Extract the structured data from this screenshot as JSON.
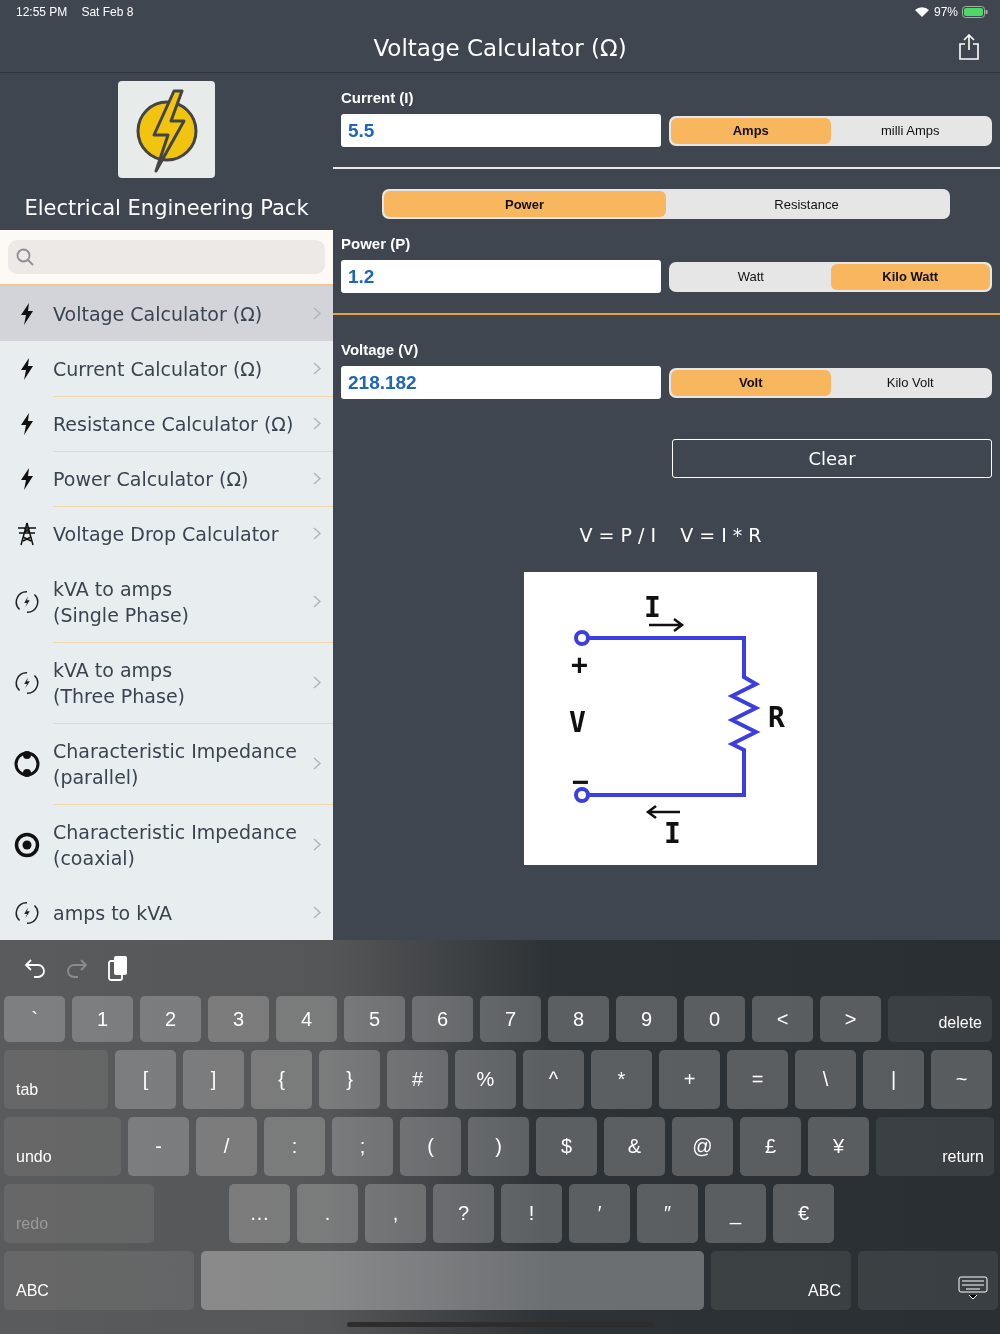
{
  "status_bar": {
    "time": "12:55 PM",
    "date": "Sat Feb 8",
    "battery": "97%"
  },
  "nav": {
    "title": "Voltage Calculator (Ω)"
  },
  "sidebar": {
    "app_title": "Electrical Engineering Pack",
    "items": [
      {
        "kind": "bolt",
        "label": "Voltage Calculator (Ω)",
        "selected": true
      },
      {
        "kind": "bolt",
        "label": "Current Calculator (Ω)",
        "selected": false
      },
      {
        "kind": "bolt",
        "label": "Resistance Calculator (Ω)",
        "selected": false
      },
      {
        "kind": "bolt",
        "label": "Power Calculator (Ω)",
        "selected": false
      },
      {
        "kind": "tower",
        "label": "Voltage Drop Calculator",
        "selected": false
      },
      {
        "kind": "cycle",
        "label": "kVA to amps\n(Single Phase)",
        "selected": false
      },
      {
        "kind": "cycle",
        "label": "kVA to amps\n(Three Phase)",
        "selected": false
      },
      {
        "kind": "parallel",
        "label": "Characteristic Impedance\n(parallel)",
        "selected": false
      },
      {
        "kind": "coaxial",
        "label": "Characteristic Impedance\n(coaxial)",
        "selected": false
      },
      {
        "kind": "cycle",
        "label": "amps to kVA",
        "selected": false
      }
    ]
  },
  "current": {
    "label": "Current (I)",
    "value": "5.5",
    "units": [
      {
        "label": "Amps",
        "selected": true
      },
      {
        "label": "milli Amps",
        "selected": false
      }
    ]
  },
  "mode": [
    {
      "label": "Power",
      "selected": true
    },
    {
      "label": "Resistance",
      "selected": false
    }
  ],
  "power": {
    "label": "Power (P)",
    "value": "1.2",
    "units": [
      {
        "label": "Watt",
        "selected": false
      },
      {
        "label": "Kilo Watt",
        "selected": true
      }
    ]
  },
  "voltage": {
    "label": "Voltage (V)",
    "value": "218.182",
    "units": [
      {
        "label": "Volt",
        "selected": true
      },
      {
        "label": "Kilo Volt",
        "selected": false
      }
    ]
  },
  "clear_button": "Clear",
  "formula": "V = P / I    V = I * R",
  "circuit_labels": [
    "I",
    "+",
    "V",
    "−",
    "R",
    "I"
  ],
  "keyboard": {
    "toolbar": [
      {
        "kind": "undo",
        "disabled": false
      },
      {
        "kind": "redo",
        "disabled": true
      },
      {
        "kind": "paste",
        "disabled": false
      }
    ],
    "rows": [
      {
        "keys": [
          {
            "kind": "char",
            "label": "`"
          },
          {
            "kind": "char",
            "label": "1"
          },
          {
            "kind": "char",
            "label": "2"
          },
          {
            "kind": "char",
            "label": "3"
          },
          {
            "kind": "char",
            "label": "4"
          },
          {
            "kind": "char",
            "label": "5"
          },
          {
            "kind": "char",
            "label": "6"
          },
          {
            "kind": "char",
            "label": "7"
          },
          {
            "kind": "char",
            "label": "8"
          },
          {
            "kind": "char",
            "label": "9"
          },
          {
            "kind": "char",
            "label": "0"
          },
          {
            "kind": "char",
            "label": "<"
          },
          {
            "kind": "char",
            "label": ">"
          },
          {
            "kind": "delete",
            "label": "delete"
          }
        ]
      },
      {
        "keys": [
          {
            "kind": "tab",
            "label": "tab"
          },
          {
            "kind": "char",
            "label": "["
          },
          {
            "kind": "char",
            "label": "]"
          },
          {
            "kind": "char",
            "label": "{"
          },
          {
            "kind": "char",
            "label": "}"
          },
          {
            "kind": "char",
            "label": "#"
          },
          {
            "kind": "char",
            "label": "%"
          },
          {
            "kind": "char",
            "label": "^"
          },
          {
            "kind": "char",
            "label": "*"
          },
          {
            "kind": "char",
            "label": "+"
          },
          {
            "kind": "char",
            "label": "="
          },
          {
            "kind": "char",
            "label": "\\"
          },
          {
            "kind": "char",
            "label": "|"
          },
          {
            "kind": "char",
            "label": "~"
          }
        ]
      },
      {
        "keys": [
          {
            "kind": "undo",
            "label": "undo"
          },
          {
            "kind": "char",
            "label": "-"
          },
          {
            "kind": "char",
            "label": "/"
          },
          {
            "kind": "char",
            "label": ":"
          },
          {
            "kind": "char",
            "label": ";"
          },
          {
            "kind": "char",
            "label": "("
          },
          {
            "kind": "char",
            "label": ")"
          },
          {
            "kind": "char",
            "label": "$"
          },
          {
            "kind": "char",
            "label": "&"
          },
          {
            "kind": "char",
            "label": "@"
          },
          {
            "kind": "char",
            "label": "£"
          },
          {
            "kind": "char",
            "label": "¥"
          },
          {
            "kind": "return",
            "label": "return"
          }
        ]
      },
      {
        "keys": [
          {
            "kind": "redo",
            "label": "redo"
          },
          {
            "kind": "char",
            "label": "…"
          },
          {
            "kind": "char",
            "label": "."
          },
          {
            "kind": "char",
            "label": ","
          },
          {
            "kind": "char",
            "label": "?"
          },
          {
            "kind": "char",
            "label": "!"
          },
          {
            "kind": "char",
            "label": "′"
          },
          {
            "kind": "char",
            "label": "″"
          },
          {
            "kind": "char",
            "label": "_"
          },
          {
            "kind": "char",
            "label": "€"
          }
        ]
      },
      {
        "keys": [
          {
            "kind": "abc",
            "label": "ABC"
          },
          {
            "kind": "space"
          },
          {
            "kind": "abc2",
            "label": "ABC"
          },
          {
            "kind": "hide"
          }
        ]
      }
    ]
  }
}
